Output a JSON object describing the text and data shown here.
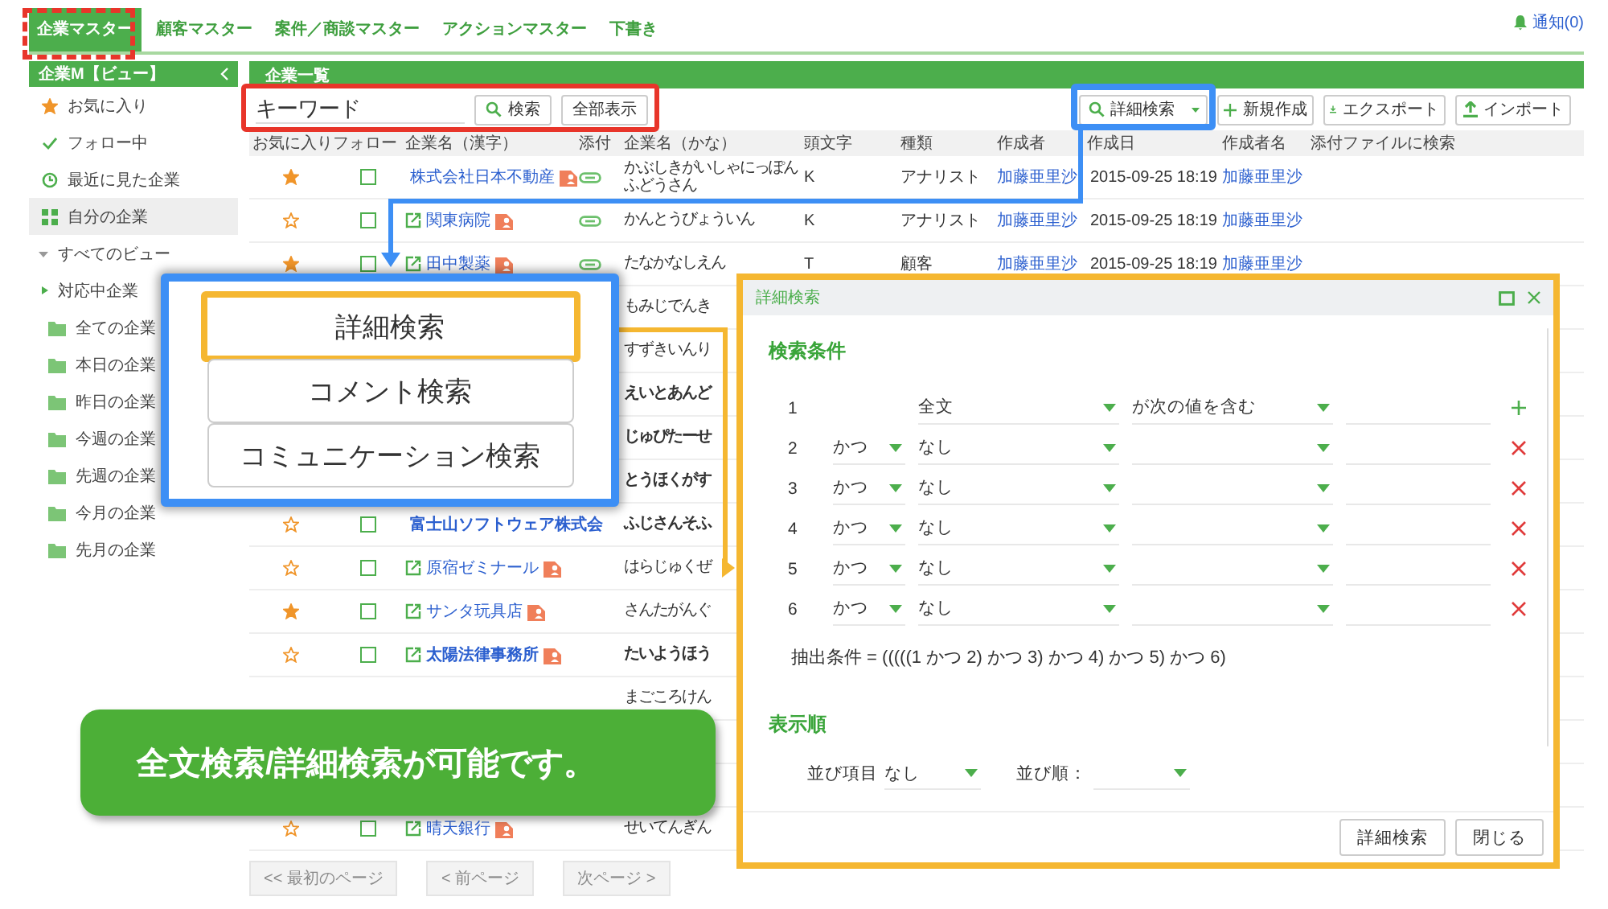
{
  "nav": {
    "tabs": [
      {
        "label": "企業マスター",
        "selected": true
      },
      {
        "label": "顧客マスター",
        "selected": false
      },
      {
        "label": "案件／商談マスター",
        "selected": false
      },
      {
        "label": "アクションマスター",
        "selected": false
      },
      {
        "label": "下書き",
        "selected": false
      }
    ],
    "notice": "通知(0)"
  },
  "sidebar": {
    "title": "企業M【ビュー】",
    "items": [
      {
        "label": "お気に入り",
        "kind": "star",
        "selected": false
      },
      {
        "label": "フォロー中",
        "kind": "check",
        "selected": false
      },
      {
        "label": "最近に見た企業",
        "kind": "clock",
        "selected": false
      },
      {
        "label": "自分の企業",
        "kind": "grid",
        "selected": true
      }
    ],
    "views": {
      "label": "すべてのビュー",
      "expanded": true,
      "children": [
        {
          "label": "対応中企業",
          "kind": "group"
        },
        {
          "label": "全ての企業",
          "kind": "folder"
        },
        {
          "label": "本日の企業",
          "kind": "folder"
        },
        {
          "label": "昨日の企業",
          "kind": "folder"
        },
        {
          "label": "今週の企業",
          "kind": "folder"
        },
        {
          "label": "先週の企業",
          "kind": "folder"
        },
        {
          "label": "今月の企業",
          "kind": "folder"
        },
        {
          "label": "先月の企業",
          "kind": "folder"
        }
      ]
    }
  },
  "main": {
    "title": "企業一覧",
    "keyword": {
      "placeholder": "キーワード"
    },
    "search_buttons": [
      {
        "label": "検索",
        "kind": "search"
      },
      {
        "label": "全部表示",
        "kind": "plain"
      }
    ],
    "actions": [
      {
        "label": "詳細検索",
        "kind": "dropdown"
      },
      {
        "label": "新規作成",
        "kind": "add"
      },
      {
        "label": "エクスポート",
        "kind": "download"
      },
      {
        "label": "インポート",
        "kind": "upload"
      }
    ],
    "columns": [
      "お気に入り",
      "フォロー",
      "企業名（漢字）",
      "添付",
      "企業名（かな）",
      "頭文字",
      "種類",
      "作成者",
      "作成日",
      "作成者名",
      "添付ファイルに検索"
    ],
    "rows": [
      {
        "favorite": true,
        "follow": false,
        "name": "株式会社日本不動産",
        "card": true,
        "attachment": true,
        "kana": "かぶしきがいしゃにっぽんふどうさん",
        "initial": "K",
        "type": "アナリスト",
        "creator": "加藤亜里沙",
        "date": "2015-09-25 18:19",
        "creator_name": "加藤亜里沙",
        "bold": false
      },
      {
        "favorite": false,
        "follow": false,
        "name": "関東病院",
        "card": true,
        "attachment": true,
        "kana": "かんとうびょういん",
        "initial": "K",
        "type": "アナリスト",
        "creator": "加藤亜里沙",
        "date": "2015-09-25 18:19",
        "creator_name": "加藤亜里沙",
        "bold": false
      },
      {
        "favorite": true,
        "follow": false,
        "name": "田中製薬",
        "card": true,
        "attachment": true,
        "kana": "たなかなしえん",
        "initial": "T",
        "type": "顧客",
        "creator": "加藤亜里沙",
        "date": "2015-09-25 18:19",
        "creator_name": "加藤亜里沙",
        "bold": false
      },
      {
        "kana": "もみじでんき",
        "bold": false
      },
      {
        "kana": "すずきいんり",
        "bold": false
      },
      {
        "kana": "えいとあんど",
        "bold": true
      },
      {
        "kana": "じゅぴたーせ",
        "bold": true
      },
      {
        "kana": "とうほくがす",
        "bold": true
      },
      {
        "favorite": false,
        "follow": false,
        "name": "富士山ソフトウェア株式会",
        "card": false,
        "attachment": false,
        "kana": "ふじさんそふ",
        "bold": true
      },
      {
        "favorite": false,
        "follow": false,
        "name": "原宿ゼミナール",
        "card": true,
        "attachment": false,
        "kana": "はらじゅくぜ",
        "bold": false
      },
      {
        "favorite": true,
        "follow": false,
        "name": "サンタ玩具店",
        "card": true,
        "attachment": false,
        "kana": "さんたがんぐ",
        "bold": false
      },
      {
        "favorite": false,
        "follow": false,
        "name": "太陽法律事務所",
        "card": true,
        "attachment": false,
        "kana": "たいようほう",
        "bold": true
      },
      {
        "kana": "まごころけん",
        "bold": false
      },
      {},
      {},
      {
        "favorite": false,
        "follow": false,
        "name": "晴天銀行",
        "card": true,
        "attachment": false,
        "kana": "せいてんぎん",
        "bold": false
      }
    ],
    "pagination": [
      {
        "label": "<< 最初のページ",
        "disabled": true
      },
      {
        "label": "< 前ページ",
        "disabled": true
      },
      {
        "label": "次ページ >",
        "disabled": true
      }
    ]
  },
  "popup": {
    "options": [
      {
        "label": "詳細検索",
        "selected": true
      },
      {
        "label": "コメント検索",
        "selected": false
      },
      {
        "label": "コミュニケーション検索",
        "selected": false
      }
    ]
  },
  "modal": {
    "title": "詳細検索",
    "conditions_heading": "検索条件",
    "conditions": [
      {
        "number": "1",
        "field": "全文",
        "operator": "が次の値を含む",
        "kind": "add"
      },
      {
        "number": "2",
        "conjunction": "かつ",
        "field": "なし",
        "kind": "remove"
      },
      {
        "number": "3",
        "conjunction": "かつ",
        "field": "なし",
        "kind": "remove"
      },
      {
        "number": "4",
        "conjunction": "かつ",
        "field": "なし",
        "kind": "remove"
      },
      {
        "number": "5",
        "conjunction": "かつ",
        "field": "なし",
        "kind": "remove"
      },
      {
        "number": "6",
        "conjunction": "かつ",
        "field": "なし",
        "kind": "remove"
      }
    ],
    "expression": "抽出条件 = (((((1 かつ 2) かつ 3) かつ 4) かつ 5) かつ 6)",
    "order_heading": "表示順",
    "sort_item_label": "並び項目",
    "sort_item_value": "なし",
    "sort_order_label": "並び順：",
    "buttons": [
      "詳細検索",
      "閉じる"
    ]
  },
  "callout": {
    "text": "全文検索/詳細検索が可能です。"
  }
}
